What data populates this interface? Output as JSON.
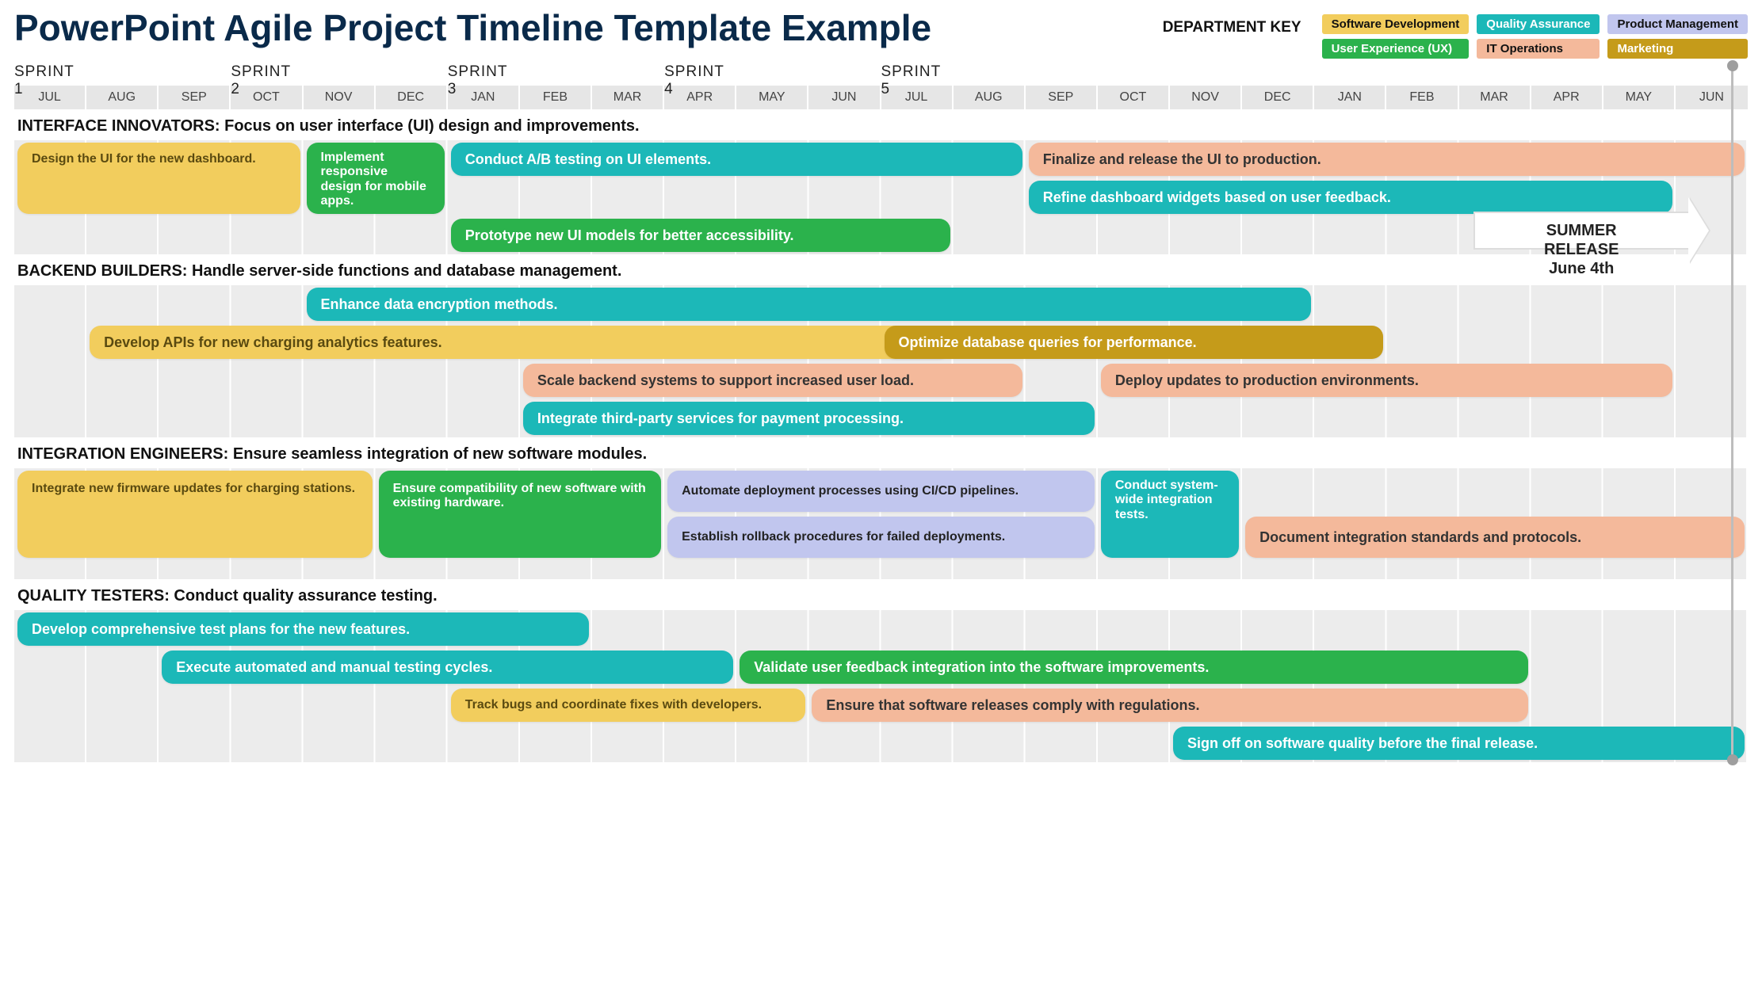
{
  "title": "PowerPoint Agile Project Timeline Template Example",
  "key": {
    "label": "DEPARTMENT KEY",
    "items": [
      {
        "label": "Software Development"
      },
      {
        "label": "User Experience (UX)"
      },
      {
        "label": "Quality Assurance"
      },
      {
        "label": "IT Operations"
      },
      {
        "label": "Product Management"
      },
      {
        "label": "Marketing"
      }
    ]
  },
  "sprints": [
    "SPRINT 1",
    "SPRINT 2",
    "SPRINT 3",
    "SPRINT 4",
    "SPRINT 5"
  ],
  "months": [
    "JUL",
    "AUG",
    "SEP",
    "OCT",
    "NOV",
    "DEC",
    "JAN",
    "FEB",
    "MAR",
    "APR",
    "MAY",
    "JUN",
    "JUL",
    "AUG",
    "SEP",
    "OCT",
    "NOV",
    "DEC",
    "JAN",
    "FEB",
    "MAR",
    "APR",
    "MAY",
    "JUN"
  ],
  "milestone": {
    "line1": "SUMMER",
    "line2": "RELEASE",
    "line3": "June 4th"
  },
  "sections": {
    "s1": {
      "title": "INTERFACE INNOVATORS: Focus on user interface (UI) design and improvements.",
      "bars": {
        "b1": "Design the UI for the new dashboard.",
        "b2": "Implement responsive design for mobile apps.",
        "b3": "Conduct A/B testing on UI elements.",
        "b4": "Finalize and release the UI to production.",
        "b5": "Refine dashboard widgets based on user feedback.",
        "b6": "Prototype new UI models for better accessibility."
      }
    },
    "s2": {
      "title": "BACKEND BUILDERS: Handle server-side functions and database management.",
      "bars": {
        "b1": "Enhance data encryption methods.",
        "b2": "Develop APIs for new charging analytics features.",
        "b3": "Optimize database queries for performance.",
        "b4": "Scale backend systems to support increased user load.",
        "b5": "Deploy updates to production environments.",
        "b6": "Integrate third-party services for payment processing."
      }
    },
    "s3": {
      "title": "INTEGRATION ENGINEERS: Ensure seamless integration of new software modules.",
      "bars": {
        "b1": "Integrate new firmware updates for charging stations.",
        "b2": "Ensure compatibility of new software with existing hardware.",
        "b3": "Automate deployment processes using CI/CD pipelines.",
        "b4": "Establish rollback procedures for failed deployments.",
        "b5": "Conduct system-wide integration tests.",
        "b6": "Document integration standards and protocols."
      }
    },
    "s4": {
      "title": "QUALITY TESTERS: Conduct quality assurance testing.",
      "bars": {
        "b1": "Develop comprehensive test plans for the new features.",
        "b2": "Execute automated and manual testing cycles.",
        "b3": "Validate user feedback integration into the software improvements.",
        "b4": "Track bugs and coordinate fixes with developers.",
        "b5": "Ensure that software releases comply with regulations.",
        "b6": "Sign off on software quality before the final release."
      }
    }
  },
  "chart_data": {
    "type": "gantt",
    "columns": 24,
    "column_labels": [
      "JUL",
      "AUG",
      "SEP",
      "OCT",
      "NOV",
      "DEC",
      "JAN",
      "FEB",
      "MAR",
      "APR",
      "MAY",
      "JUN",
      "JUL",
      "AUG",
      "SEP",
      "OCT",
      "NOV",
      "DEC",
      "JAN",
      "FEB",
      "MAR",
      "APR",
      "MAY",
      "JUN"
    ],
    "sprint_markers": [
      {
        "label": "SPRINT 1",
        "col": 1
      },
      {
        "label": "SPRINT 2",
        "col": 4
      },
      {
        "label": "SPRINT 3",
        "col": 7
      },
      {
        "label": "SPRINT 4",
        "col": 10
      },
      {
        "label": "SPRINT 5",
        "col": 13
      }
    ],
    "milestone": {
      "label": "SUMMER RELEASE June 4th",
      "col": 24
    },
    "lanes": [
      {
        "name": "INTERFACE INNOVATORS",
        "bars": [
          {
            "label": "Design the UI for the new dashboard.",
            "dept": "Software Development",
            "start": 1,
            "end": 4,
            "row": 1
          },
          {
            "label": "Implement responsive design for mobile apps.",
            "dept": "User Experience (UX)",
            "start": 5,
            "end": 6,
            "row": 1
          },
          {
            "label": "Conduct A/B testing on UI elements.",
            "dept": "Quality Assurance",
            "start": 7,
            "end": 14,
            "row": 1
          },
          {
            "label": "Finalize and release the UI to production.",
            "dept": "IT Operations",
            "start": 15,
            "end": 24,
            "row": 1
          },
          {
            "label": "Refine dashboard widgets based on user feedback.",
            "dept": "Quality Assurance",
            "start": 15,
            "end": 23,
            "row": 2
          },
          {
            "label": "Prototype new UI models for better accessibility.",
            "dept": "User Experience (UX)",
            "start": 7,
            "end": 13,
            "row": 3
          }
        ]
      },
      {
        "name": "BACKEND BUILDERS",
        "bars": [
          {
            "label": "Enhance data encryption methods.",
            "dept": "Quality Assurance",
            "start": 5,
            "end": 18,
            "row": 1
          },
          {
            "label": "Develop APIs for new charging analytics features.",
            "dept": "Software Development",
            "start": 2,
            "end": 13,
            "row": 2
          },
          {
            "label": "Optimize database queries for performance.",
            "dept": "Marketing",
            "start": 13,
            "end": 19,
            "row": 2
          },
          {
            "label": "Scale backend systems to support increased user load.",
            "dept": "IT Operations",
            "start": 8,
            "end": 14,
            "row": 3
          },
          {
            "label": "Deploy updates to production environments.",
            "dept": "IT Operations",
            "start": 16,
            "end": 23,
            "row": 3
          },
          {
            "label": "Integrate third-party services for payment processing.",
            "dept": "Quality Assurance",
            "start": 8,
            "end": 15,
            "row": 4
          }
        ]
      },
      {
        "name": "INTEGRATION ENGINEERS",
        "bars": [
          {
            "label": "Integrate new firmware updates for charging stations.",
            "dept": "Software Development",
            "start": 1,
            "end": 5,
            "row": 1
          },
          {
            "label": "Ensure compatibility of new software with existing hardware.",
            "dept": "User Experience (UX)",
            "start": 6,
            "end": 9,
            "row": 1
          },
          {
            "label": "Automate deployment processes using CI/CD pipelines.",
            "dept": "Product Management",
            "start": 10,
            "end": 15,
            "row": 1
          },
          {
            "label": "Establish rollback procedures for failed deployments.",
            "dept": "Product Management",
            "start": 10,
            "end": 15,
            "row": 2
          },
          {
            "label": "Conduct system-wide integration tests.",
            "dept": "Quality Assurance",
            "start": 16,
            "end": 17,
            "row": 1
          },
          {
            "label": "Document integration standards and protocols.",
            "dept": "IT Operations",
            "start": 18,
            "end": 24,
            "row": 2
          }
        ]
      },
      {
        "name": "QUALITY TESTERS",
        "bars": [
          {
            "label": "Develop comprehensive test plans for the new features.",
            "dept": "Quality Assurance",
            "start": 1,
            "end": 8,
            "row": 1
          },
          {
            "label": "Execute automated and manual testing cycles.",
            "dept": "Quality Assurance",
            "start": 3,
            "end": 10,
            "row": 2
          },
          {
            "label": "Validate user feedback integration into the software improvements.",
            "dept": "User Experience (UX)",
            "start": 11,
            "end": 21,
            "row": 2
          },
          {
            "label": "Track bugs and coordinate fixes with developers.",
            "dept": "Software Development",
            "start": 7,
            "end": 11,
            "row": 3
          },
          {
            "label": "Ensure that software releases comply with regulations.",
            "dept": "IT Operations",
            "start": 12,
            "end": 21,
            "row": 3
          },
          {
            "label": "Sign off on software quality before the final release.",
            "dept": "Quality Assurance",
            "start": 17,
            "end": 24,
            "row": 4
          }
        ]
      }
    ]
  }
}
